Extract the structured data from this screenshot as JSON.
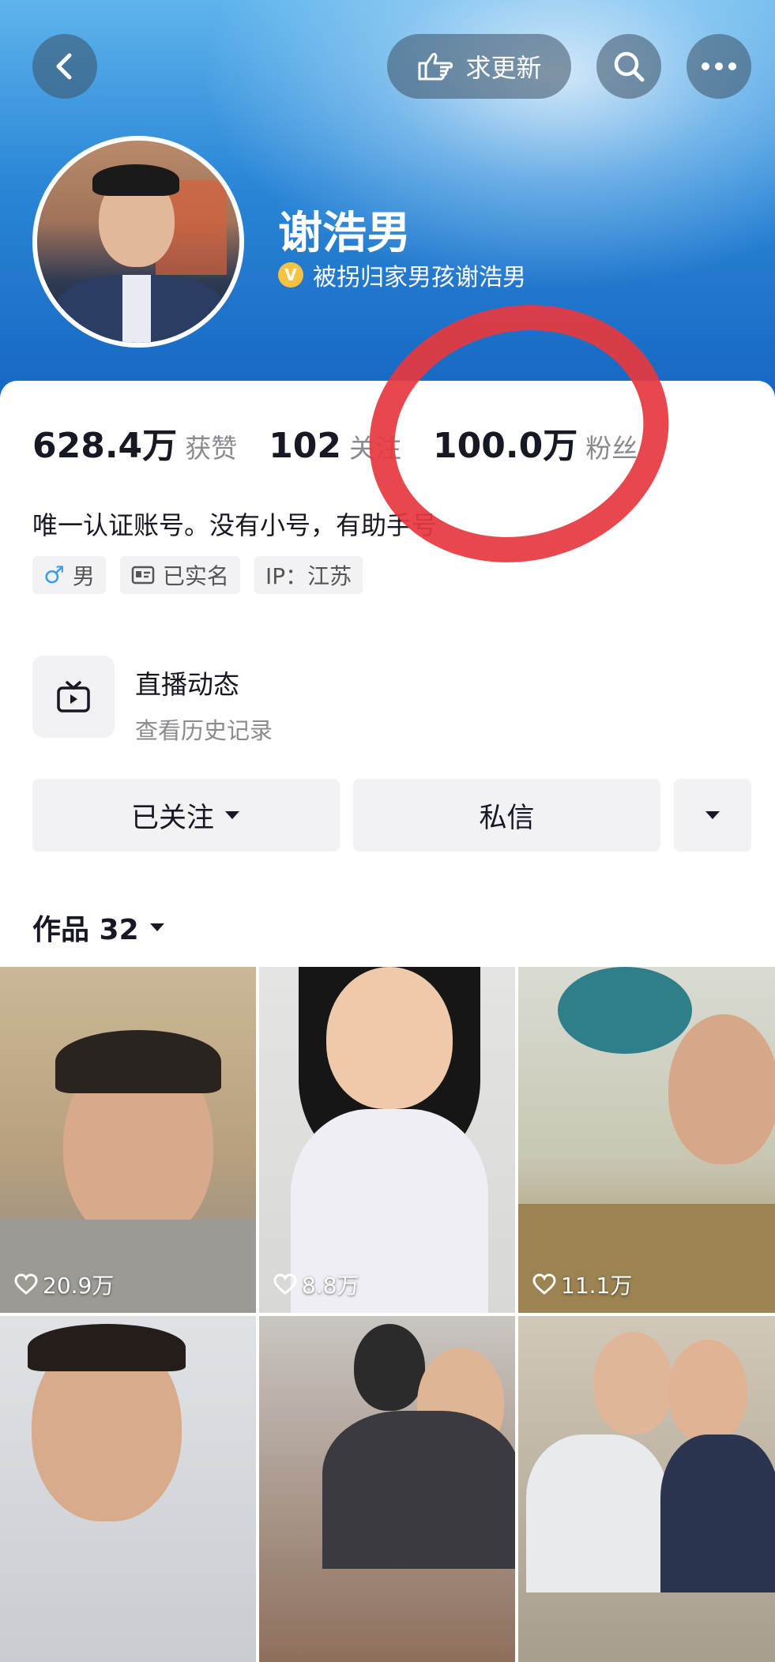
{
  "header": {
    "request_update_label": "求更新",
    "back_icon": "chevron-left-icon",
    "search_icon": "search-icon",
    "more_icon": "more-horizontal-icon"
  },
  "profile": {
    "name": "谢浩男",
    "verification": "被拐归家男孩谢浩男",
    "bio": "唯一认证账号。没有小号，有助手号"
  },
  "stats": [
    {
      "value": "628.4万",
      "label": "获赞"
    },
    {
      "value": "102",
      "label": "关注"
    },
    {
      "value": "100.0万",
      "label": "粉丝"
    }
  ],
  "tags": {
    "gender": "男",
    "realname": "已实名",
    "ip": "IP：江苏"
  },
  "live": {
    "title": "直播动态",
    "subtitle": "查看历史记录"
  },
  "actions": {
    "follow": "已关注",
    "message": "私信"
  },
  "works": {
    "label": "作品 32",
    "items": [
      {
        "likes": "20.9万"
      },
      {
        "likes": "8.8万"
      },
      {
        "likes": "11.1万"
      },
      {
        "likes": ""
      },
      {
        "likes": ""
      },
      {
        "likes": ""
      }
    ]
  },
  "colors": {
    "header_gradient_top": "#5fb4ec",
    "header_gradient_bottom": "#1565c2",
    "annotation_red": "#e5393f",
    "verify_gold": "#f5c242"
  }
}
